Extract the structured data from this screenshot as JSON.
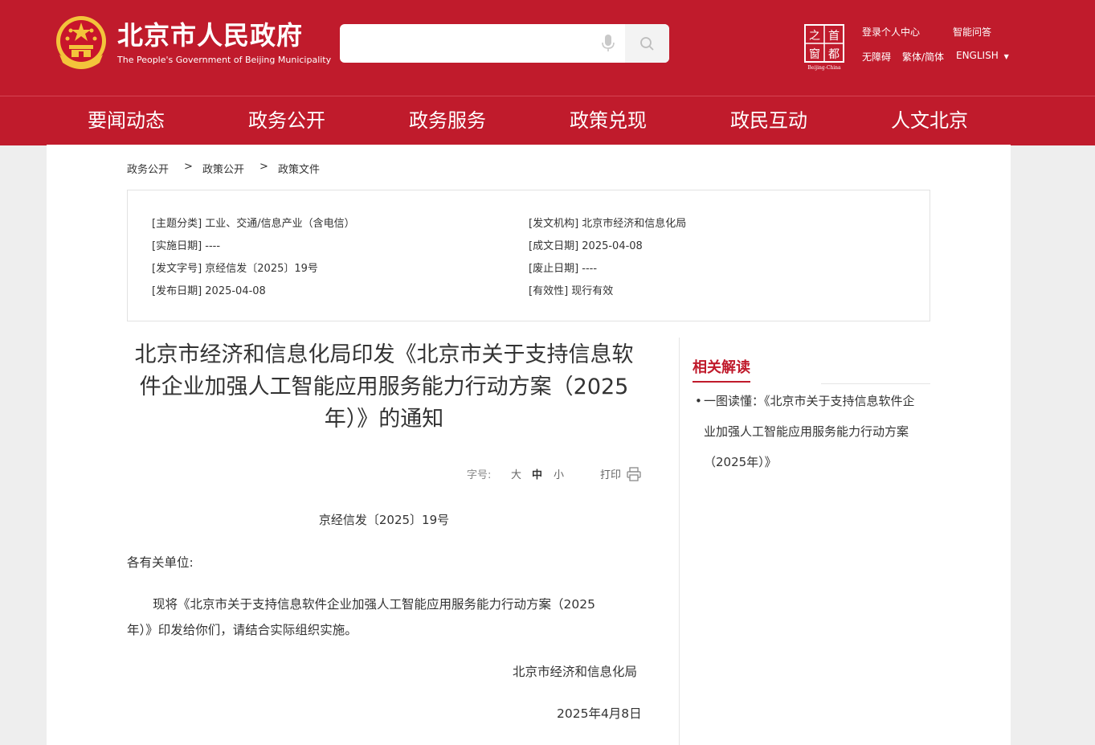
{
  "header": {
    "site_name": "北京市人民政府",
    "site_name_en": "The People's Government of Beijing Municipality",
    "search_placeholder": "",
    "logo_capital_chars": [
      "之",
      "首",
      "窗",
      "都"
    ],
    "logo_capital_caption": "Beijing-China",
    "links": {
      "personal_center": "登录个人中心",
      "smart_qa": "智能问答",
      "accessibility": "无障碍",
      "traditional_simplified": "繁体/简体",
      "english": "ENGLISH"
    },
    "icons": [
      "emblem-icon",
      "mic-icon",
      "search-icon",
      "capital-window-logo",
      "dropdown-arrow-icon"
    ]
  },
  "nav": {
    "items": [
      "要闻动态",
      "政务公开",
      "政务服务",
      "政策兑现",
      "政民互动",
      "人文北京"
    ]
  },
  "breadcrumb": {
    "items": [
      "政务公开",
      "政策公开",
      "政策文件"
    ],
    "separator": ">"
  },
  "meta": {
    "topic": "[主题分类] 工业、交通/信息产业（含电信）",
    "issuer": "[发文机构] 北京市经济和信息化局",
    "effective_date": "[实施日期] ----",
    "created_date": "[成文日期] 2025-04-08",
    "doc_number": "[发文字号] 京经信发〔2025〕19号",
    "abolish_date": "[废止日期] ----",
    "publish_date": "[发布日期] 2025-04-08",
    "validity": "[有效性] 现行有效"
  },
  "article": {
    "title": "北京市经济和信息化局印发《北京市关于支持信息软件企业加强人工智能应用服务能力行动方案（2025年）》的通知",
    "font_size_label": "字号:",
    "font_sizes": [
      "大",
      "中",
      "小"
    ],
    "print_label": "打印",
    "doc_no": "京经信发〔2025〕19号",
    "salutation": "各有关单位:",
    "paragraph": "现将《北京市关于支持信息软件企业加强人工智能应用服务能力行动方案（2025年）》印发给你们，请结合实际组织实施。",
    "signature": "北京市经济和信息化局",
    "date": "2025年4月8日"
  },
  "related": {
    "title": "相关解读",
    "items": [
      "一图读懂：《北京市关于支持信息软件企业加强人工智能应用服务能力行动方案（2025年）》"
    ]
  },
  "colors": {
    "brand_red": "#c01b2c",
    "page_bg": "#eeeeee"
  }
}
